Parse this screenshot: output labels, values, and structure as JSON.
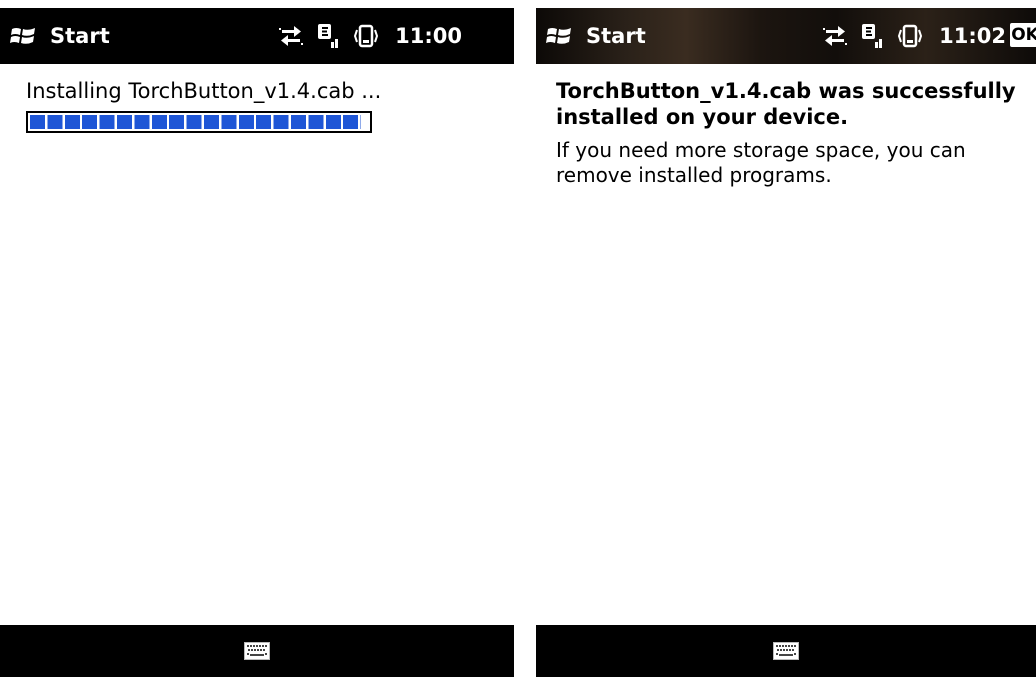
{
  "screens": [
    {
      "titlebar": {
        "start_label": "Start",
        "time": "11:00",
        "icons": [
          "windows-logo-icon",
          "data-sync-icon",
          "signal-edge-icon",
          "vibrate-icon"
        ]
      },
      "content": {
        "status_text": "Installing TorchButton_v1.4.cab ...",
        "progress_fraction": 0.98
      },
      "bottombar": {
        "icons": [
          "keyboard-icon"
        ]
      }
    },
    {
      "titlebar": {
        "start_label": "Start",
        "time": "11:02",
        "ok_label": "OK",
        "icons": [
          "windows-logo-icon",
          "data-sync-icon",
          "signal-edge-icon",
          "vibrate-icon"
        ]
      },
      "content": {
        "title": "TorchButton_v1.4.cab was successfully installed on your device.",
        "body": "If you need more storage space, you can remove installed programs."
      },
      "bottombar": {
        "icons": [
          "keyboard-icon"
        ]
      }
    }
  ],
  "colors": {
    "progress_fill": "#1f56d6",
    "bars": "#000000",
    "background": "#ffffff"
  }
}
